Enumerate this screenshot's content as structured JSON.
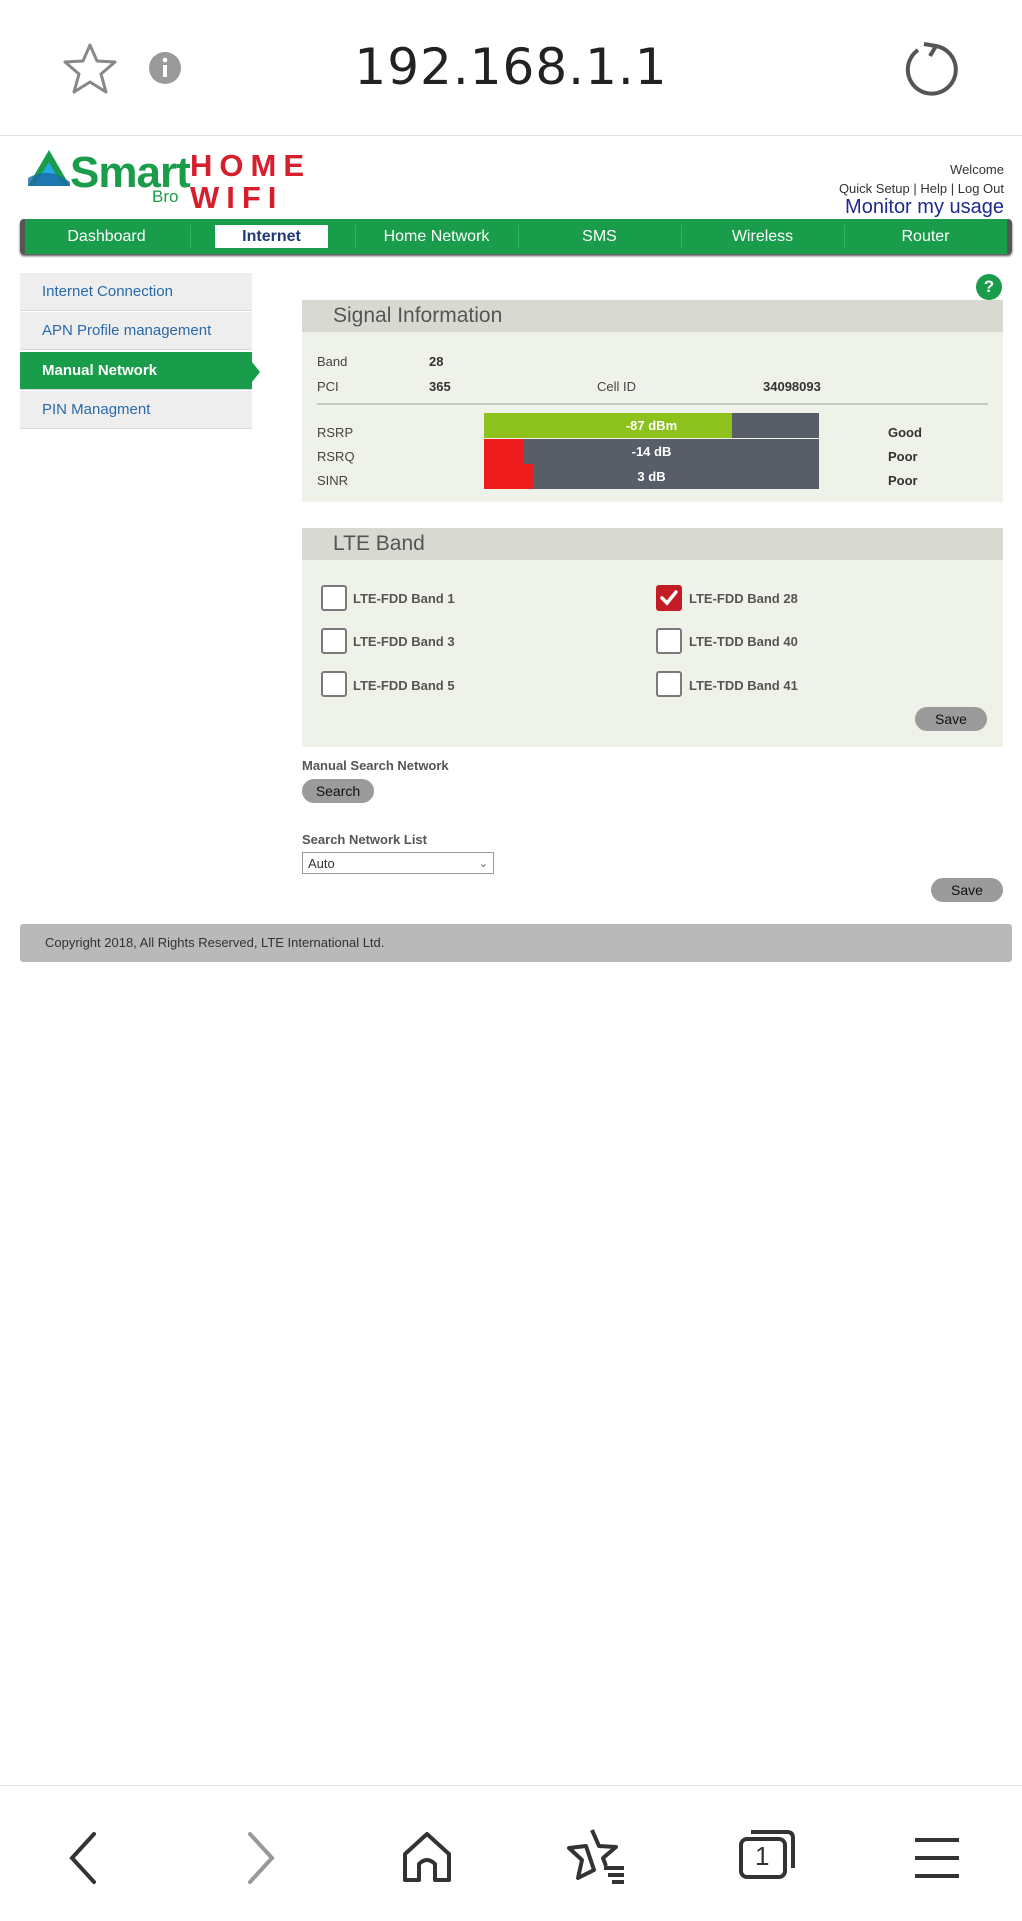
{
  "browser": {
    "url": "192.168.1.1",
    "icons": [
      "star-icon",
      "info-icon",
      "reload-icon",
      "back-icon",
      "forward-icon",
      "home-icon",
      "bookmarks-icon",
      "tabs-icon",
      "menu-icon"
    ],
    "tab_count": "1"
  },
  "header": {
    "logo_smart": "Smart",
    "logo_bro": "Bro",
    "logo_home": "HOME",
    "logo_wifi": "WIFI",
    "welcome": "Welcome",
    "quick_setup": "Quick Setup",
    "help": "Help",
    "logout": "Log Out",
    "monitor": "Monitor my usage"
  },
  "nav": {
    "items": [
      "Dashboard",
      "Internet",
      "Home Network",
      "SMS",
      "Wireless",
      "Router"
    ],
    "active": "Internet"
  },
  "sidebar": {
    "items": [
      "Internet Connection",
      "APN Profile management",
      "Manual Network",
      "PIN Managment"
    ],
    "active": "Manual Network"
  },
  "signal": {
    "title": "Signal Information",
    "band_label": "Band",
    "band_value": "28",
    "pci_label": "PCI",
    "pci_value": "365",
    "cellid_label": "Cell ID",
    "cellid_value": "34098093",
    "metrics": [
      {
        "label": "RSRP",
        "value": "-87 dBm",
        "quality": "Good",
        "fill_fraction": 0.74,
        "color": "#8cc21b"
      },
      {
        "label": "RSRQ",
        "value": "-14 dB",
        "quality": "Poor",
        "fill_fraction": 0.12,
        "color": "#ee1c1c"
      },
      {
        "label": "SINR",
        "value": "3 dB",
        "quality": "Poor",
        "fill_fraction": 0.15,
        "color": "#ee1c1c"
      }
    ]
  },
  "lte_band": {
    "title": "LTE Band",
    "bands": [
      {
        "label": "LTE-FDD Band 1",
        "checked": false
      },
      {
        "label": "LTE-FDD Band 28",
        "checked": true
      },
      {
        "label": "LTE-FDD Band 3",
        "checked": false
      },
      {
        "label": "LTE-TDD Band 40",
        "checked": false
      },
      {
        "label": "LTE-FDD Band 5",
        "checked": false
      },
      {
        "label": "LTE-TDD Band 41",
        "checked": false
      }
    ],
    "save_label": "Save"
  },
  "manual_search": {
    "label": "Manual Search Network",
    "button": "Search"
  },
  "network_list": {
    "label": "Search Network List",
    "selected": "Auto",
    "save_label": "Save"
  },
  "footer": {
    "copyright": "Copyright 2018, All Rights Reserved, LTE International Ltd."
  },
  "colors": {
    "brand_green": "#1a9d4b",
    "brand_red": "#d61f2c",
    "panel_bg": "#eef2e8"
  }
}
